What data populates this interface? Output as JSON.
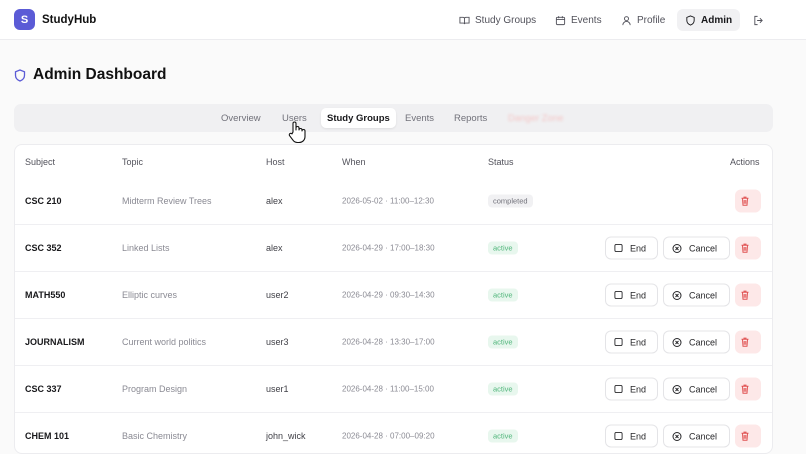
{
  "app": {
    "logo_letter": "S",
    "name": "StudyHub"
  },
  "nav": [
    {
      "label": "Study Groups",
      "icon": "book-icon"
    },
    {
      "label": "Events",
      "icon": "calendar-icon"
    },
    {
      "label": "Profile",
      "icon": "user-icon"
    },
    {
      "label": "Admin",
      "icon": "shield-icon",
      "active": true
    }
  ],
  "page": {
    "title": "Admin Dashboard"
  },
  "tabs": [
    {
      "label": "Overview"
    },
    {
      "label": "Users"
    },
    {
      "label": "Study Groups",
      "active": true
    },
    {
      "label": "Events"
    },
    {
      "label": "Reports"
    },
    {
      "label": "Danger Zone",
      "faded": true
    }
  ],
  "table": {
    "headers": {
      "subject": "Subject",
      "topic": "Topic",
      "host": "Host",
      "when": "When",
      "status": "Status",
      "actions": "Actions"
    },
    "end_label": "End",
    "cancel_label": "Cancel",
    "rows": [
      {
        "subject": "CSC 210",
        "topic": "Midterm Review Trees",
        "host": "alex",
        "when": "2026-05-02 · 11:00–12:30",
        "status": "completed"
      },
      {
        "subject": "CSC 352",
        "topic": "Linked Lists",
        "host": "alex",
        "when": "2026-04-29 · 17:00–18:30",
        "status": "active"
      },
      {
        "subject": "MATH550",
        "topic": "Elliptic curves",
        "host": "user2",
        "when": "2026-04-29 · 09:30–14:30",
        "status": "active"
      },
      {
        "subject": "JOURNALISM",
        "topic": "Current world politics",
        "host": "user3",
        "when": "2026-04-28 · 13:30–17:00",
        "status": "active"
      },
      {
        "subject": "CSC 337",
        "topic": "Program Design",
        "host": "user1",
        "when": "2026-04-28 · 11:00–15:00",
        "status": "active"
      },
      {
        "subject": "CHEM 101",
        "topic": "Basic Chemistry",
        "host": "john_wick",
        "when": "2026-04-28 · 07:00–09:20",
        "status": "active"
      }
    ]
  },
  "colors": {
    "brand": "#5b5bd6",
    "active_badge": "#4fb57a",
    "delete": "#e05252"
  }
}
